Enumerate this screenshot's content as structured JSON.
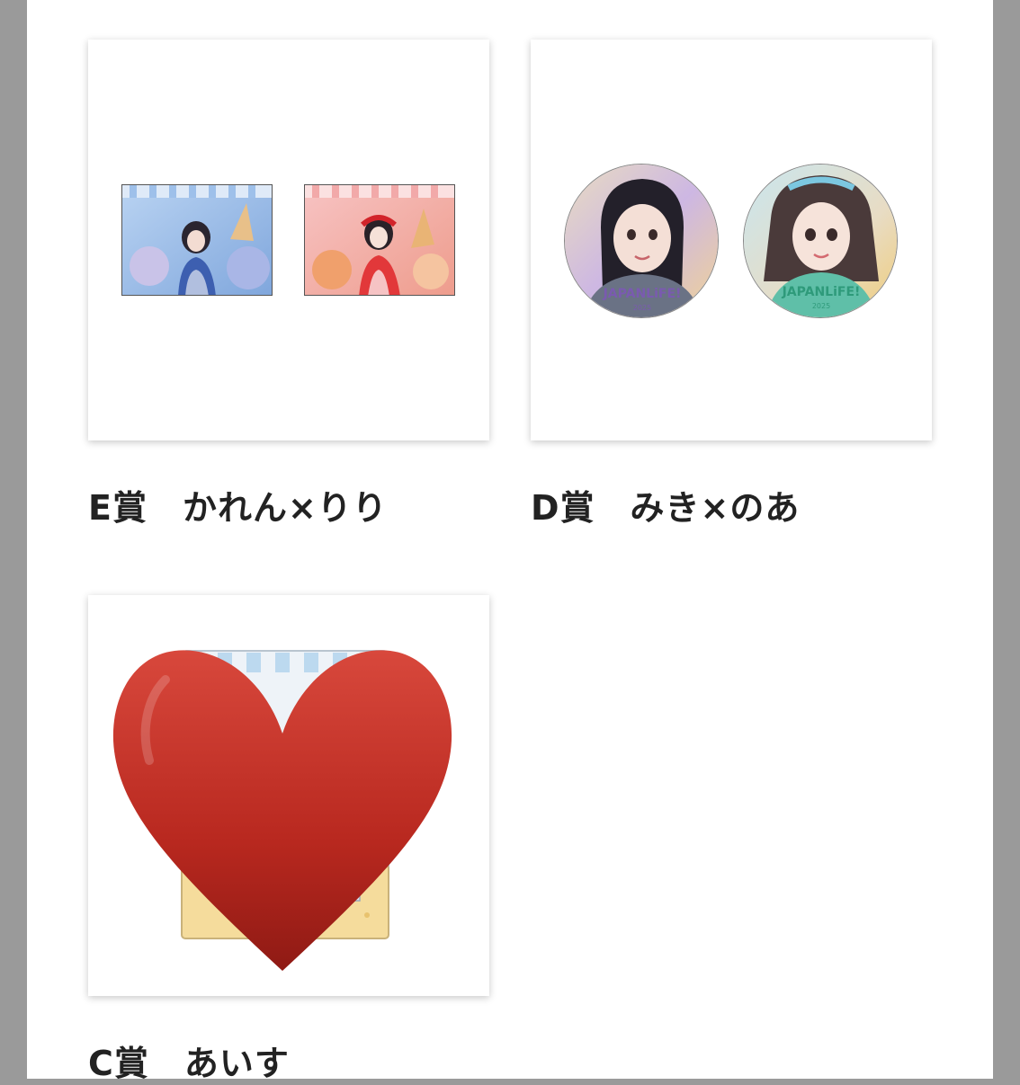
{
  "prizes": [
    {
      "label": "E賞　かれん×りり",
      "item": "photo-cards"
    },
    {
      "label": "D賞　みき×のあ",
      "item": "can-badges"
    },
    {
      "label": "C賞　あいす",
      "item": "acrylic-stand"
    }
  ],
  "badge_logo_text": "JAPANLiFE!",
  "badge_logo_year": "2025",
  "colors": {
    "side_gutter": "#9a9a9a",
    "page_bg": "#ffffff",
    "heart": "#c22a22",
    "label_text": "#222222"
  },
  "icons": [
    "heart-sticker-icon"
  ]
}
